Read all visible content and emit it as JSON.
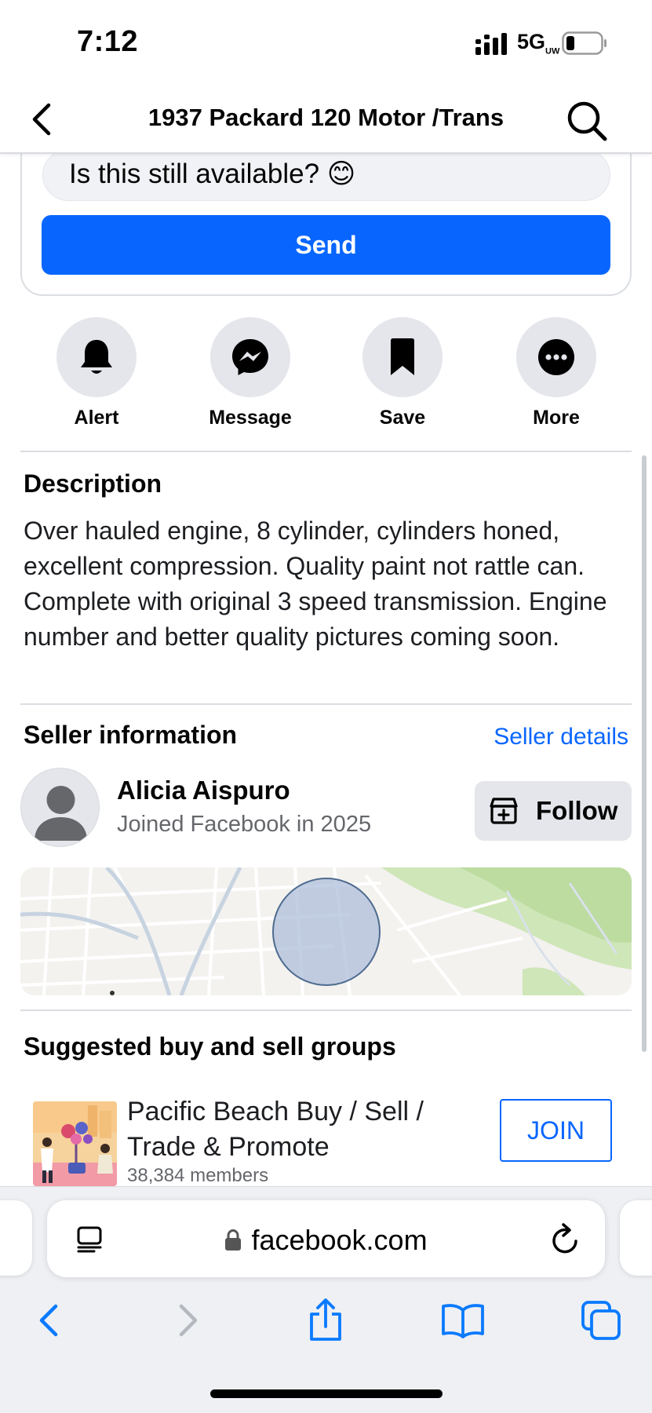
{
  "status_bar": {
    "time": "7:12",
    "network": "5G",
    "network_sub": "UW"
  },
  "header": {
    "title": "1937 Packard 120 Motor /Trans",
    "back_icon": "chevron-left-icon",
    "search_icon": "search-icon"
  },
  "message": {
    "input_value": "Is this still available? 😊",
    "send_label": "Send"
  },
  "actions": [
    {
      "label": "Alert",
      "icon": "bell-icon"
    },
    {
      "label": "Message",
      "icon": "messenger-icon"
    },
    {
      "label": "Save",
      "icon": "bookmark-icon"
    },
    {
      "label": "More",
      "icon": "more-icon"
    }
  ],
  "description": {
    "title": "Description",
    "text": "Over hauled engine, 8 cylinder, cylinders honed, excellent compression. Quality paint not rattle can. Complete with original 3 speed transmission. Engine number and better quality pictures coming soon."
  },
  "seller": {
    "title": "Seller information",
    "details_link": "Seller details",
    "name": "Alicia Aispuro",
    "joined": "Joined Facebook in 2025",
    "follow_label": "Follow"
  },
  "groups": {
    "title": "Suggested buy and sell groups",
    "items": [
      {
        "name": "Pacific Beach Buy / Sell / Trade & Promote",
        "members": "38,384 members",
        "join_label": "JOIN"
      }
    ]
  },
  "browser": {
    "url": "facebook.com"
  },
  "colors": {
    "accent": "#0866ff",
    "secondary_bg": "#e4e6eb",
    "muted_text": "#65676b"
  }
}
